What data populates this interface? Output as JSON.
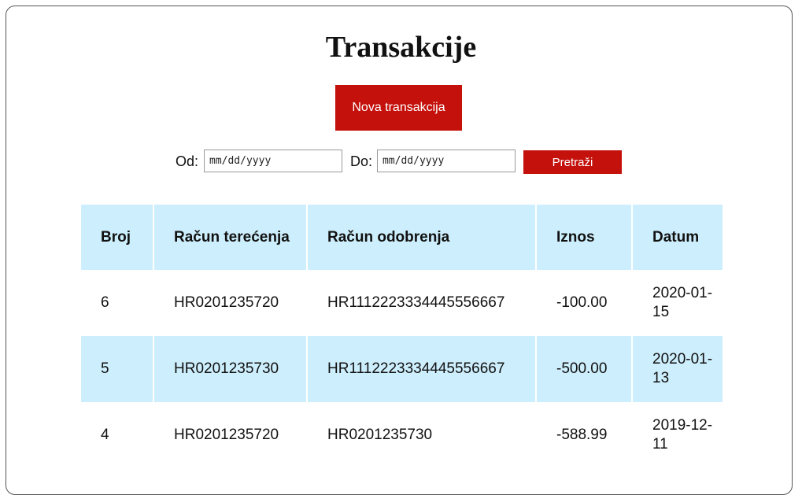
{
  "page": {
    "title": "Transakcije"
  },
  "actions": {
    "new_transaction_label": "Nova transakcija"
  },
  "filter": {
    "from_label": "Od:",
    "from_placeholder": "mm/dd/yyyy",
    "to_label": "Do:",
    "to_placeholder": "mm/dd/yyyy",
    "search_label": "Pretraži"
  },
  "table": {
    "headers": [
      "Broj",
      "Račun terećenja",
      "Račun odobrenja",
      "Iznos",
      "Datum"
    ],
    "rows": [
      [
        "6",
        "HR0201235720",
        "HR1112223334445556667",
        "-100.00",
        "2020-01-15"
      ],
      [
        "5",
        "HR0201235730",
        "HR1112223334445556667",
        "-500.00",
        "2020-01-13"
      ],
      [
        "4",
        "HR0201235720",
        "HR0201235730",
        "-588.99",
        "2019-12-11"
      ]
    ]
  },
  "colors": {
    "accent": "#c4110c",
    "table_tint": "#cdeefc"
  }
}
